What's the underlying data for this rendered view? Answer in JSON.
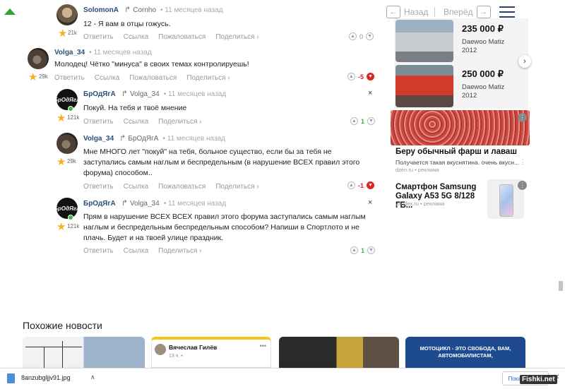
{
  "nav": {
    "back_label": "Назад",
    "forward_label": "Вперёд"
  },
  "comments": [
    {
      "author": "SolomonA",
      "reply_to": "Cornho",
      "time": "• 11 месяцев назад",
      "text": "12 - Я вам в отцы гожусь.",
      "rating": "21k",
      "score": "0",
      "actions": [
        "Ответить",
        "Ссылка",
        "Пожаловаться",
        "Поделиться ›"
      ]
    },
    {
      "author": "Volga_34",
      "reply_to": "",
      "time": "• 11 месяцев назад",
      "text": "Молодец! Чётко \"минуса\" в своих темах контролируешь!",
      "rating": "29k",
      "score": "-5",
      "actions": [
        "Ответить",
        "Ссылка",
        "Пожаловаться",
        "Поделиться ›"
      ]
    },
    {
      "author": "БрОдЯгА",
      "reply_to": "Volga_34",
      "time": "• 11 месяцев назад",
      "text": "Покуй. На тебя и твоё мнение",
      "rating": "121k",
      "score": "1",
      "actions": [
        "Ответить",
        "Ссылка",
        "Поделиться ›"
      ]
    },
    {
      "author": "Volga_34",
      "reply_to": "БрОдЯгА",
      "time": "• 11 месяцев назад",
      "text": "Мне МНОГО лет \"покуй\" на тебя, больное существо, если бы за тебя не заступались самым наглым и беспредельным (в нарушение ВСЕХ правил этого форума) способом..",
      "rating": "29k",
      "score": "-1",
      "actions": [
        "Ответить",
        "Ссылка",
        "Пожаловаться",
        "Поделиться ›"
      ]
    },
    {
      "author": "БрОдЯгА",
      "reply_to": "Volga_34",
      "time": "• 11 месяцев назад",
      "text": "Прям в нарушение ВСЕХ ВСЕХ правил этого форума заступались самым наглым наглым и беспредельным беспредельным способом? Напиши в Спортлото и не плачь. Будет и на твоей улице праздник.",
      "rating": "121k",
      "score": "1",
      "actions": [
        "Ответить",
        "Ссылка",
        "Поделиться ›"
      ]
    }
  ],
  "cars": [
    {
      "price": "235 000 ₽",
      "model": "Daewoo Matiz",
      "year": "2012"
    },
    {
      "price": "250 000 ₽",
      "model": "Daewoo Matiz",
      "year": "2012"
    }
  ],
  "ads": [
    {
      "title": "Беру обычный фарш и лаваш",
      "desc": "Получается такая вкуснятина. очень вкусн...",
      "source": "dzen.ru • реклама"
    },
    {
      "title": "Смартфон Samsung Galaxy A53 5G 8/128 ГБ...",
      "source": "yandex.ru • реклама"
    }
  ],
  "similar": {
    "title": "Похожие новости",
    "card2_author": "Вячеслав Гилёв",
    "card2_time": "13 ч. •",
    "card4_text": "МОТОЦИКЛ - ЭТО СВОБОДА, ВАМ, АВТОМОБИЛИСТАМ,"
  },
  "download": {
    "filename": "8anzubgljjv91.jpg",
    "show_all": "Показать все"
  },
  "watermark": "Fishki.net"
}
